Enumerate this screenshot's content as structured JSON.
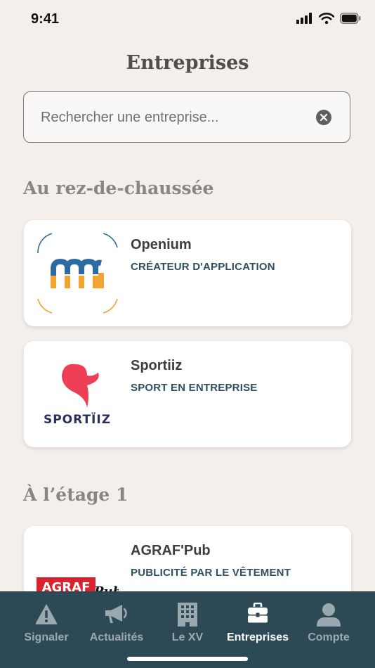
{
  "status": {
    "time": "9:41"
  },
  "header": {
    "title": "Entreprises"
  },
  "search": {
    "placeholder": "Rechercher une entreprise..."
  },
  "sections": [
    {
      "title": "Au rez-de-chaussée",
      "companies": [
        {
          "name": "Openium",
          "category": "CRÉATEUR D'APPLICATION",
          "logo_icon": "openium-logo"
        },
        {
          "name": "Sportiiz",
          "category": "SPORT EN ENTREPRISE",
          "logo_icon": "sportiiz-logo",
          "logo_text": "SPORTÏIZ"
        }
      ]
    },
    {
      "title": "À l’étage 1",
      "companies": [
        {
          "name": "AGRAF'Pub",
          "category": "PUBLICITÉ PAR LE VÊTEMENT",
          "logo_icon": "agrafpub-logo",
          "logo_text_main": "AGRAF",
          "logo_text_script": "Pub"
        }
      ]
    }
  ],
  "tabbar": {
    "tabs": [
      {
        "label": "Signaler",
        "icon": "warning-icon"
      },
      {
        "label": "Actualités",
        "icon": "megaphone-icon"
      },
      {
        "label": "Le XV",
        "icon": "building-icon"
      },
      {
        "label": "Entreprises",
        "icon": "briefcase-icon",
        "active": true
      },
      {
        "label": "Compte",
        "icon": "user-icon"
      }
    ]
  },
  "colors": {
    "background": "#f4efea",
    "tabbar": "#2e4956",
    "category": "#2f4f60",
    "sportiiz_red": "#ef3f55",
    "agraf_red": "#d9232e"
  }
}
